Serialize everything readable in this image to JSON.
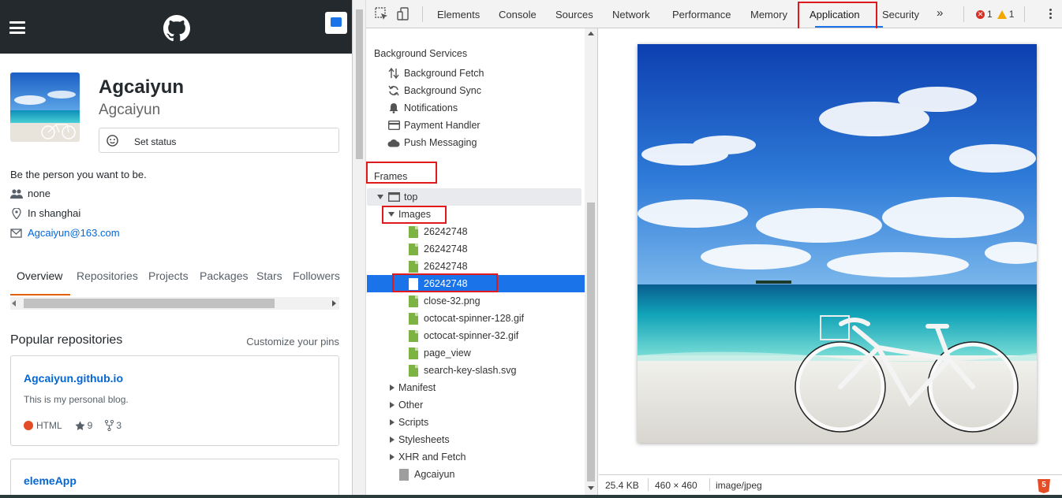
{
  "github": {
    "name": "Agcaiyun",
    "login": "Agcaiyun",
    "set_status": "Set status",
    "bio": "Be the person you want to be.",
    "company": "none",
    "location": "In shanghai",
    "email": "Agcaiyun@163.com",
    "tabs": [
      "Overview",
      "Repositories",
      "Projects",
      "Packages",
      "Stars",
      "Followers"
    ],
    "popular_title": "Popular repositories",
    "customize_pins": "Customize your pins",
    "repos": [
      {
        "name": "Agcaiyun.github.io",
        "description": "This is my personal blog.",
        "language": "HTML",
        "stars": "9",
        "forks": "3"
      },
      {
        "name": "elemeApp"
      }
    ],
    "colors": {
      "header": "#24292e",
      "link": "#0366d6",
      "tab_underline": "#e36209",
      "html_lang": "#e34c26"
    }
  },
  "devtools": {
    "tabs": [
      "Elements",
      "Console",
      "Sources",
      "Network",
      "Performance",
      "Memory",
      "Application",
      "Security"
    ],
    "active_tab": "Application",
    "overflow": "»",
    "errors": "1",
    "warnings": "1",
    "sidebar": {
      "background_services_title": "Background Services",
      "background_services": [
        {
          "label": "Background Fetch",
          "icon": "updown-arrows-icon"
        },
        {
          "label": "Background Sync",
          "icon": "sync-icon"
        },
        {
          "label": "Notifications",
          "icon": "bell-icon"
        },
        {
          "label": "Payment Handler",
          "icon": "card-icon"
        },
        {
          "label": "Push Messaging",
          "icon": "cloud-icon"
        }
      ],
      "frames_title": "Frames",
      "top": "top",
      "images_folder": "Images",
      "images": [
        "26242748",
        "26242748",
        "26242748",
        "26242748",
        "close-32.png",
        "octocat-spinner-128.gif",
        "octocat-spinner-32.gif",
        "page_view",
        "search-key-slash.svg"
      ],
      "selected_image_index": 3,
      "folders": [
        "Manifest",
        "Other",
        "Scripts",
        "Stylesheets",
        "XHR and Fetch"
      ],
      "document": "Agcaiyun"
    },
    "preview": {
      "size": "25.4 KB",
      "dimensions": "460 × 460",
      "mime": "image/jpeg"
    },
    "colors": {
      "accent": "#1a73e8",
      "highlight_box": "#e0191c",
      "file_icon": "#7cb342"
    }
  }
}
